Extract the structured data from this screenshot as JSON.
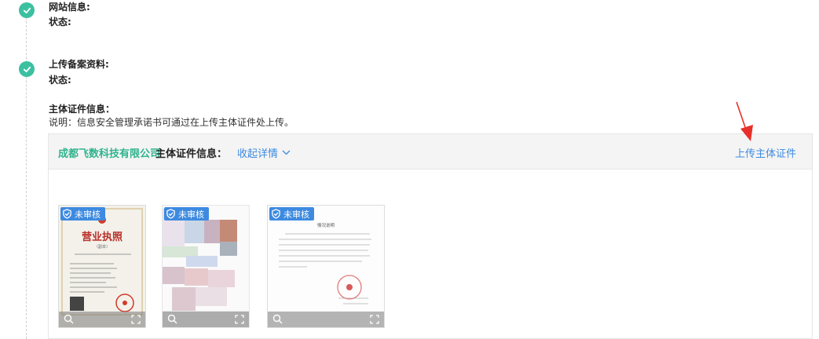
{
  "steps": [
    {
      "title": "网站信息:",
      "status": "状态:"
    },
    {
      "title": "上传备案资料:",
      "status": "状态:"
    }
  ],
  "cert_section": {
    "title": "主体证件信息：",
    "note": "说明：信息安全管理承诺书可通过在上传主体证件处上传。"
  },
  "panel": {
    "company": "成都飞数科技有限公司",
    "cert_label": "主体证件信息：",
    "collapse_label": "收起详情",
    "upload_label": "上传主体证件"
  },
  "thumbnails": [
    {
      "badge": "未审核",
      "doc_title": "营业执照",
      "doc_subtitle": "（副本）"
    },
    {
      "badge": "未审核"
    },
    {
      "badge": "未审核",
      "doc_title": "情况说明"
    }
  ],
  "colors": {
    "accent_green": "#3bc0a0",
    "link_blue": "#3d8ae0",
    "arrow_red": "#e8302a"
  }
}
